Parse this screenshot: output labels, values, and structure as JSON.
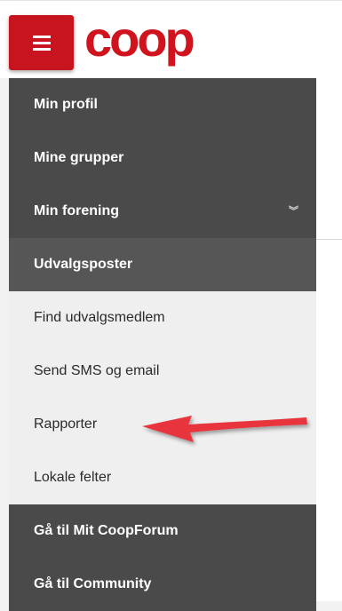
{
  "header": {
    "logo_text": "coop",
    "menu_icon": "hamburger-menu-icon",
    "brand_color": "#c8141f"
  },
  "menu": {
    "items": [
      {
        "label": "Min profil"
      },
      {
        "label": "Mine grupper"
      },
      {
        "label": "Min forening",
        "icon": "chevron-double-down-icon"
      },
      {
        "label": "Udvalgsposter"
      },
      {
        "label": "Find udvalgsmedlem"
      },
      {
        "label": "Send SMS og email"
      },
      {
        "label": "Rapporter"
      },
      {
        "label": "Lokale felter"
      },
      {
        "label": "Gå til Mit CoopForum"
      },
      {
        "label": "Gå til Community"
      }
    ]
  },
  "annotation": {
    "arrow_color": "#e8343c",
    "points_to": "Rapporter"
  }
}
